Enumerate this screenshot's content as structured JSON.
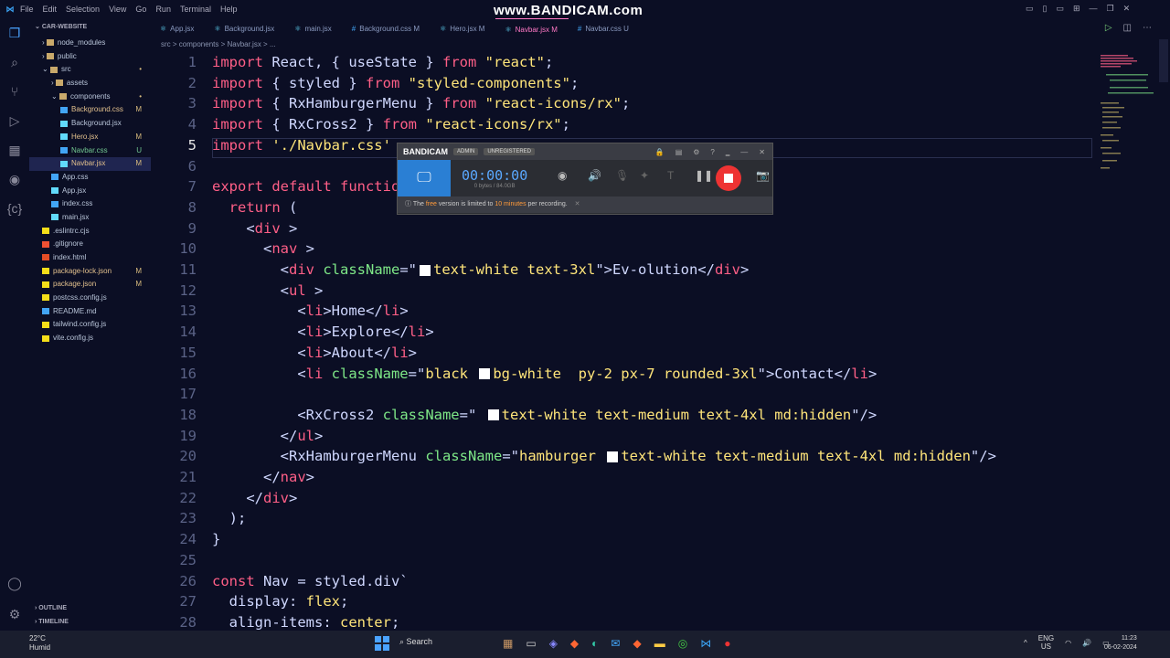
{
  "titlebar": {
    "menu": [
      "File",
      "Edit",
      "Selection",
      "View",
      "Go",
      "Run",
      "Terminal",
      "Help"
    ],
    "watermark": "www.BANDICAM.com",
    "controls": [
      "▭",
      "▯",
      "▭",
      "⊞",
      "—",
      "❐",
      "✕"
    ]
  },
  "explorer": {
    "title": "CAR-WEBSITE",
    "items": [
      {
        "label": "node_modules",
        "indent": 1,
        "type": "folder",
        "badge": ""
      },
      {
        "label": "public",
        "indent": 1,
        "type": "folder",
        "badge": ""
      },
      {
        "label": "src",
        "indent": 1,
        "type": "folder-open",
        "badge": "•"
      },
      {
        "label": "assets",
        "indent": 2,
        "type": "folder",
        "badge": ""
      },
      {
        "label": "components",
        "indent": 2,
        "type": "folder-open",
        "badge": "•"
      },
      {
        "label": "Background.css",
        "indent": 3,
        "type": "css",
        "badge": "M"
      },
      {
        "label": "Background.jsx",
        "indent": 3,
        "type": "jsx",
        "badge": ""
      },
      {
        "label": "Hero.jsx",
        "indent": 3,
        "type": "jsx",
        "badge": "M"
      },
      {
        "label": "Navbar.css",
        "indent": 3,
        "type": "css",
        "badge": "U"
      },
      {
        "label": "Navbar.jsx",
        "indent": 3,
        "type": "jsx",
        "badge": "M",
        "selected": true
      },
      {
        "label": "App.css",
        "indent": 2,
        "type": "css",
        "badge": ""
      },
      {
        "label": "App.jsx",
        "indent": 2,
        "type": "jsx",
        "badge": ""
      },
      {
        "label": "index.css",
        "indent": 2,
        "type": "css",
        "badge": ""
      },
      {
        "label": "main.jsx",
        "indent": 2,
        "type": "jsx",
        "badge": ""
      },
      {
        "label": ".eslintrc.cjs",
        "indent": 1,
        "type": "js",
        "badge": ""
      },
      {
        "label": ".gitignore",
        "indent": 1,
        "type": "git",
        "badge": ""
      },
      {
        "label": "index.html",
        "indent": 1,
        "type": "html",
        "badge": ""
      },
      {
        "label": "package-lock.json",
        "indent": 1,
        "type": "json",
        "badge": "M"
      },
      {
        "label": "package.json",
        "indent": 1,
        "type": "json",
        "badge": "M"
      },
      {
        "label": "postcss.config.js",
        "indent": 1,
        "type": "js",
        "badge": ""
      },
      {
        "label": "README.md",
        "indent": 1,
        "type": "md",
        "badge": ""
      },
      {
        "label": "tailwind.config.js",
        "indent": 1,
        "type": "js",
        "badge": ""
      },
      {
        "label": "vite.config.js",
        "indent": 1,
        "type": "js",
        "badge": ""
      }
    ],
    "outline": "OUTLINE",
    "timeline": "TIMELINE"
  },
  "tabs": [
    {
      "label": "App.jsx",
      "active": false
    },
    {
      "label": "Background.jsx",
      "active": false
    },
    {
      "label": "main.jsx",
      "active": false
    },
    {
      "label": "Background.css M",
      "active": false
    },
    {
      "label": "Hero.jsx M",
      "active": false
    },
    {
      "label": "Navbar.jsx M",
      "active": true
    },
    {
      "label": "Navbar.css U",
      "active": false
    }
  ],
  "breadcrumb": "src > components > Navbar.jsx > ...",
  "code": [
    {
      "n": "1",
      "segs": [
        [
          "kw",
          "import "
        ],
        [
          "id",
          "React, { "
        ],
        [
          "id",
          "useState"
        ],
        [
          "id",
          " } "
        ],
        [
          "kw",
          "from "
        ],
        [
          "str",
          "\"react\""
        ],
        [
          "id",
          ";"
        ]
      ]
    },
    {
      "n": "2",
      "segs": [
        [
          "kw",
          "import "
        ],
        [
          "id",
          "{ styled } "
        ],
        [
          "kw",
          "from "
        ],
        [
          "str",
          "\"styled-components\""
        ],
        [
          "id",
          ";"
        ]
      ]
    },
    {
      "n": "3",
      "segs": [
        [
          "kw",
          "import "
        ],
        [
          "id",
          "{ RxHamburgerMenu } "
        ],
        [
          "kw",
          "from "
        ],
        [
          "str",
          "\"react-icons/rx\""
        ],
        [
          "id",
          ";"
        ]
      ]
    },
    {
      "n": "4",
      "segs": [
        [
          "kw",
          "import "
        ],
        [
          "id",
          "{ RxCross2 } "
        ],
        [
          "kw",
          "from "
        ],
        [
          "str",
          "\"react-icons/rx\""
        ],
        [
          "id",
          ";"
        ]
      ]
    },
    {
      "n": "5",
      "segs": [
        [
          "kw",
          "import "
        ],
        [
          "str",
          "'./Navbar.css'"
        ]
      ]
    },
    {
      "n": "6",
      "segs": []
    },
    {
      "n": "7",
      "segs": [
        [
          "kw",
          "export default "
        ],
        [
          "kw",
          "functio"
        ]
      ]
    },
    {
      "n": "8",
      "segs": [
        [
          "kw",
          "  return "
        ],
        [
          "id",
          "("
        ]
      ]
    },
    {
      "n": "9",
      "segs": [
        [
          "id",
          "    <"
        ],
        [
          "tag",
          "div"
        ],
        [
          "id",
          " >"
        ]
      ]
    },
    {
      "n": "10",
      "segs": [
        [
          "id",
          "      <"
        ],
        [
          "tag",
          "nav"
        ],
        [
          "id",
          " >"
        ]
      ]
    },
    {
      "n": "11",
      "segs": [
        [
          "id",
          "        <"
        ],
        [
          "tag",
          "div "
        ],
        [
          "attr",
          "className"
        ],
        [
          "id",
          "=\""
        ],
        [
          "sq",
          ""
        ],
        [
          "str",
          "text-white text-3xl"
        ],
        [
          "id",
          "\">Ev-olution</"
        ],
        [
          "tag",
          "div"
        ],
        [
          "id",
          ">"
        ]
      ]
    },
    {
      "n": "12",
      "segs": [
        [
          "id",
          "        <"
        ],
        [
          "tag",
          "ul"
        ],
        [
          "id",
          " >"
        ]
      ]
    },
    {
      "n": "13",
      "segs": [
        [
          "id",
          "          <"
        ],
        [
          "tag",
          "li"
        ],
        [
          "id",
          ">Home</"
        ],
        [
          "tag",
          "li"
        ],
        [
          "id",
          ">"
        ]
      ]
    },
    {
      "n": "14",
      "segs": [
        [
          "id",
          "          <"
        ],
        [
          "tag",
          "li"
        ],
        [
          "id",
          ">Explore</"
        ],
        [
          "tag",
          "li"
        ],
        [
          "id",
          ">"
        ]
      ]
    },
    {
      "n": "15",
      "segs": [
        [
          "id",
          "          <"
        ],
        [
          "tag",
          "li"
        ],
        [
          "id",
          ">About</"
        ],
        [
          "tag",
          "li"
        ],
        [
          "id",
          ">"
        ]
      ]
    },
    {
      "n": "16",
      "segs": [
        [
          "id",
          "          <"
        ],
        [
          "tag",
          "li "
        ],
        [
          "attr",
          "className"
        ],
        [
          "id",
          "=\""
        ],
        [
          "str",
          "black "
        ],
        [
          "sq",
          ""
        ],
        [
          "str",
          "bg-white  py-2 px-7 rounded-3xl"
        ],
        [
          "id",
          "\">Contact</"
        ],
        [
          "tag",
          "li"
        ],
        [
          "id",
          ">"
        ]
      ]
    },
    {
      "n": "17",
      "segs": []
    },
    {
      "n": "18",
      "segs": [
        [
          "id",
          "          <"
        ],
        [
          "id",
          "RxCross2 "
        ],
        [
          "attr",
          "className"
        ],
        [
          "id",
          "=\" "
        ],
        [
          "sq",
          ""
        ],
        [
          "str",
          "text-white text-medium text-4xl md:hidden"
        ],
        [
          "id",
          "\"/>"
        ]
      ]
    },
    {
      "n": "19",
      "segs": [
        [
          "id",
          "        </"
        ],
        [
          "tag",
          "ul"
        ],
        [
          "id",
          ">"
        ]
      ]
    },
    {
      "n": "20",
      "segs": [
        [
          "id",
          "        <"
        ],
        [
          "id",
          "RxHamburgerMenu "
        ],
        [
          "attr",
          "className"
        ],
        [
          "id",
          "=\""
        ],
        [
          "str",
          "hamburger "
        ],
        [
          "sq",
          ""
        ],
        [
          "str",
          "text-white text-medium text-4xl md:hidden"
        ],
        [
          "id",
          "\"/>"
        ]
      ]
    },
    {
      "n": "21",
      "segs": [
        [
          "id",
          "      </"
        ],
        [
          "tag",
          "nav"
        ],
        [
          "id",
          ">"
        ]
      ]
    },
    {
      "n": "22",
      "segs": [
        [
          "id",
          "    </"
        ],
        [
          "tag",
          "div"
        ],
        [
          "id",
          ">"
        ]
      ]
    },
    {
      "n": "23",
      "segs": [
        [
          "id",
          "  );"
        ]
      ]
    },
    {
      "n": "24",
      "segs": [
        [
          "id",
          "}"
        ]
      ]
    },
    {
      "n": "25",
      "segs": []
    },
    {
      "n": "26",
      "segs": [
        [
          "kw",
          "const "
        ],
        [
          "id",
          "Nav = "
        ],
        [
          "id",
          "styled.div`"
        ]
      ]
    },
    {
      "n": "27",
      "segs": [
        [
          "id",
          "  display: "
        ],
        [
          "str",
          "flex"
        ],
        [
          "id",
          ";"
        ]
      ]
    },
    {
      "n": "28",
      "segs": [
        [
          "id",
          "  align-items: "
        ],
        [
          "str",
          "center"
        ],
        [
          "id",
          ";"
        ]
      ]
    }
  ],
  "bandicam": {
    "logo": "BANDICAM",
    "pill1": "ADMIN",
    "pill2": "UNREGISTERED",
    "timer": "00:00:00",
    "size": "0 bytes / 84.0GB",
    "info_pre": "The ",
    "info_free": "free",
    "info_mid": " version is limited to ",
    "info_limit": "10 minutes",
    "info_post": " per recording."
  },
  "taskbar": {
    "temp": "22°C",
    "weather": "Humid",
    "search": "Search",
    "lang1": "ENG",
    "lang2": "US",
    "time": "11:23",
    "date": "06-02-2024"
  }
}
